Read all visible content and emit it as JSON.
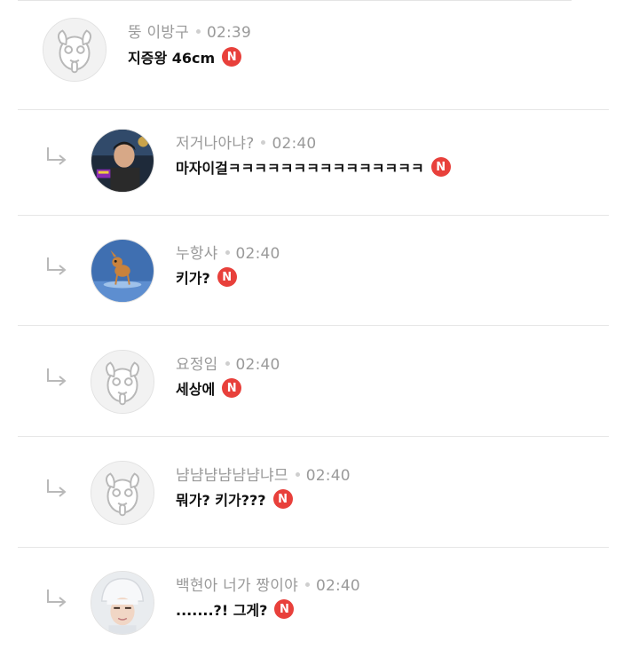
{
  "comments": [
    {
      "author": "뚱 이방구",
      "time": "02:39",
      "text": "지증왕 46cm",
      "badge": "N",
      "is_reply": false,
      "avatar": "dog-avatar-icon"
    },
    {
      "author": "저거나아냐?",
      "time": "02:40",
      "text": "마자이걸ㅋㅋㅋㅋㅋㅋㅋㅋㅋㅋㅋㅋㅋㅋㅋ",
      "badge": "N",
      "is_reply": true,
      "avatar": "man-photo-avatar"
    },
    {
      "author": "누항샤",
      "time": "02:40",
      "text": "키가?",
      "badge": "N",
      "is_reply": true,
      "avatar": "bambi-avatar"
    },
    {
      "author": "요정임",
      "time": "02:40",
      "text": "세상에",
      "badge": "N",
      "is_reply": true,
      "avatar": "dog-avatar-icon"
    },
    {
      "author": "냠냠냠냠냠냠냐므",
      "time": "02:40",
      "text": "뭐가? 키가???",
      "badge": "N",
      "is_reply": true,
      "avatar": "dog-avatar-icon"
    },
    {
      "author": "백현아 너가 짱이야",
      "time": "02:40",
      "text": ".......?! 그게?",
      "badge": "N",
      "is_reply": true,
      "avatar": "hat-person-avatar"
    }
  ],
  "colors": {
    "badge": "#e8403b",
    "meta": "#9a9a9a",
    "separator": "#e6e6e6"
  }
}
